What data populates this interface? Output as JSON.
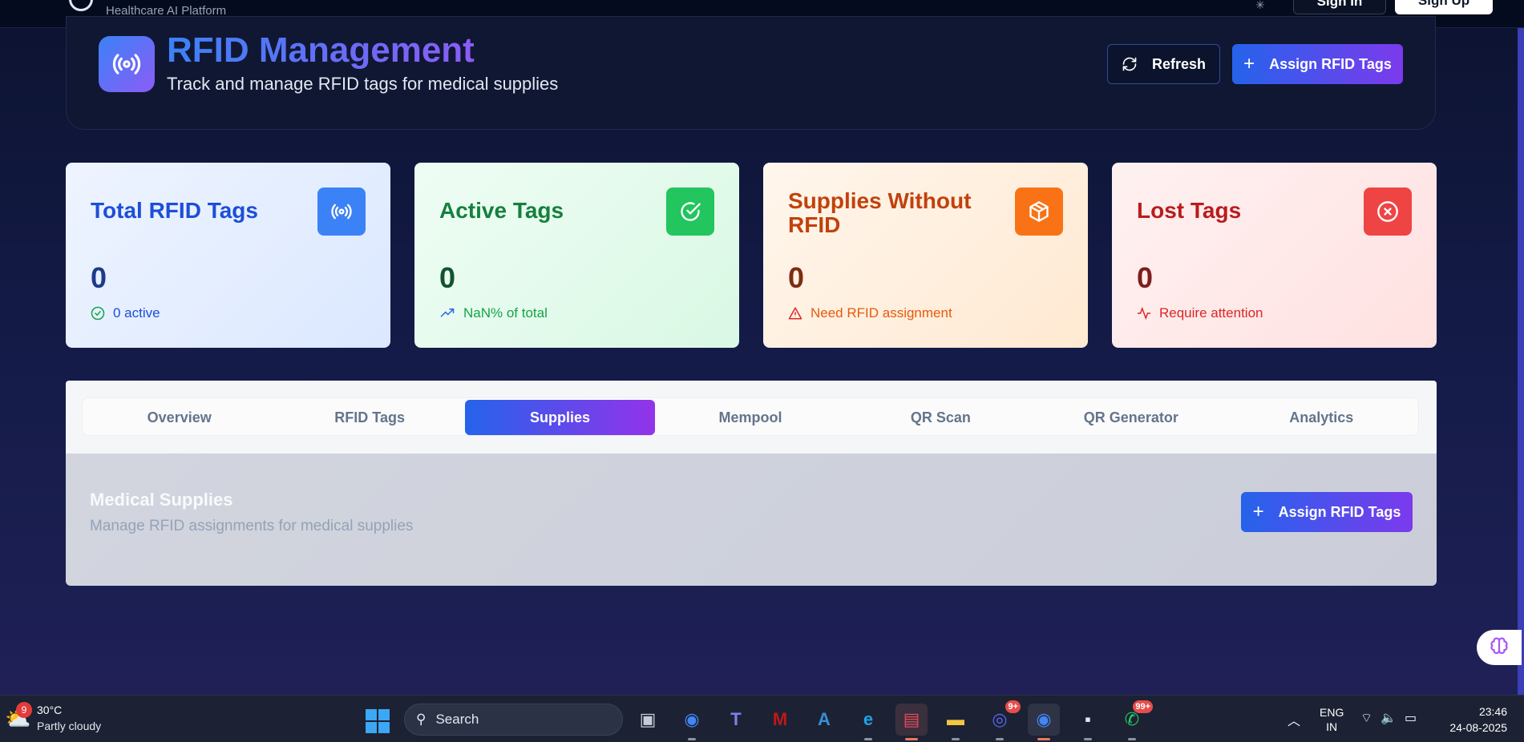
{
  "topnav": {
    "platform_subtitle": "Healthcare AI Platform",
    "sign_in_label": "Sign In",
    "sign_up_label": "Sign Up"
  },
  "header": {
    "title": "RFID Management",
    "subtitle": "Track and manage RFID tags for medical supplies",
    "refresh_label": "Refresh",
    "assign_label": "Assign RFID Tags"
  },
  "stats": [
    {
      "title": "Total RFID Tags",
      "value": "0",
      "footnote": "0 active",
      "icon": "broadcast-icon",
      "accent": "#3b82f6"
    },
    {
      "title": "Active Tags",
      "value": "0",
      "footnote": "NaN% of total",
      "icon": "check-circle-icon",
      "accent": "#22c55e"
    },
    {
      "title": "Supplies Without RFID",
      "value": "0",
      "footnote": "Need RFID assignment",
      "icon": "package-icon",
      "accent": "#f97316"
    },
    {
      "title": "Lost Tags",
      "value": "0",
      "footnote": "Require attention",
      "icon": "x-circle-icon",
      "accent": "#ef4444"
    }
  ],
  "tabs": [
    {
      "label": "Overview",
      "active": false
    },
    {
      "label": "RFID Tags",
      "active": false
    },
    {
      "label": "Supplies",
      "active": true
    },
    {
      "label": "Mempool",
      "active": false
    },
    {
      "label": "QR Scan",
      "active": false
    },
    {
      "label": "QR Generator",
      "active": false
    },
    {
      "label": "Analytics",
      "active": false
    }
  ],
  "supplies": {
    "title": "Medical Supplies",
    "subtitle": "Manage RFID assignments for medical supplies",
    "assign_label": "Assign RFID Tags"
  },
  "taskbar": {
    "weather_temp": "30°C",
    "weather_desc": "Partly cloudy",
    "weather_badge": "9",
    "search_placeholder": "Search",
    "discord_badge": "9+",
    "whatsapp_badge": "99+",
    "lang_line1": "ENG",
    "lang_line2": "IN",
    "time": "23:46",
    "date": "24-08-2025"
  }
}
